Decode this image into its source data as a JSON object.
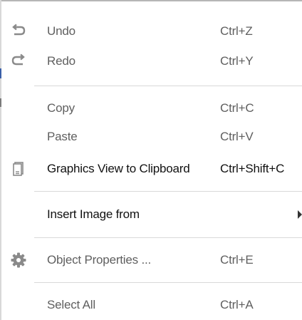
{
  "menu": {
    "items": [
      {
        "label": "Undo",
        "shortcut": "Ctrl+Z",
        "icon": "undo-icon",
        "enabled": false
      },
      {
        "label": "Redo",
        "shortcut": "Ctrl+Y",
        "icon": "redo-icon",
        "enabled": false
      },
      {
        "label": "Copy",
        "shortcut": "Ctrl+C",
        "icon": "",
        "enabled": false
      },
      {
        "label": "Paste",
        "shortcut": "Ctrl+V",
        "icon": "",
        "enabled": false
      },
      {
        "label": "Graphics View to Clipboard",
        "shortcut": "Ctrl+Shift+C",
        "icon": "clipboard-icon",
        "enabled": true
      },
      {
        "label": "Insert Image from",
        "shortcut": "",
        "icon": "",
        "enabled": true,
        "submenu": true
      },
      {
        "label": "Object Properties ...",
        "shortcut": "Ctrl+E",
        "icon": "gear-icon",
        "enabled": false
      },
      {
        "label": "Select All",
        "shortcut": "Ctrl+A",
        "icon": "",
        "enabled": false
      }
    ]
  },
  "colors": {
    "enabled_text": "#111111",
    "disabled_text": "#5f5f5f",
    "separator": "#d9d9d9",
    "icon": "#888888"
  }
}
